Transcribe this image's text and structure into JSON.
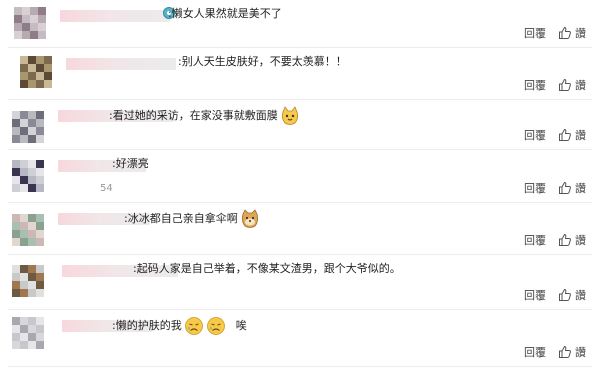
{
  "comments": [
    {
      "sep": ":",
      "text": "懒女人果然就是美不了",
      "extra": "",
      "emojis": [],
      "after": "",
      "reply": "回覆",
      "like": "讚"
    },
    {
      "sep": ":",
      "text": "别人天生皮肤好，不要太羡慕！！",
      "extra": "",
      "emojis": [],
      "after": "",
      "reply": "回覆",
      "like": "讚"
    },
    {
      "sep": ":",
      "text": "看过她的采访，在家没事就敷面膜",
      "extra": "",
      "emojis": [
        "cat-emoji"
      ],
      "after": "",
      "reply": "回覆",
      "like": "讚"
    },
    {
      "sep": ":",
      "text": "好漂亮",
      "extra": "54",
      "emojis": [],
      "after": "",
      "reply": "回覆",
      "like": "讚"
    },
    {
      "sep": ":",
      "text": "冰冰都自己亲自拿伞啊",
      "extra": "",
      "emojis": [
        "doge-emoji"
      ],
      "after": "",
      "reply": "回覆",
      "like": "讚"
    },
    {
      "sep": ":",
      "text": "起码人家是自己举着，不像某文渣男，跟个大爷似的。",
      "extra": "",
      "emojis": [],
      "after": "",
      "reply": "回覆",
      "like": "讚"
    },
    {
      "sep": ":",
      "text": "懒的护肤的我",
      "extra": "",
      "emojis": [
        "sad-face-emoji",
        "sad-face-emoji"
      ],
      "after": "唉",
      "reply": "回覆",
      "like": "讚"
    }
  ],
  "colors": {
    "text": "#222222",
    "divider": "#ececec",
    "emoji_yellow": "#f7c948"
  }
}
